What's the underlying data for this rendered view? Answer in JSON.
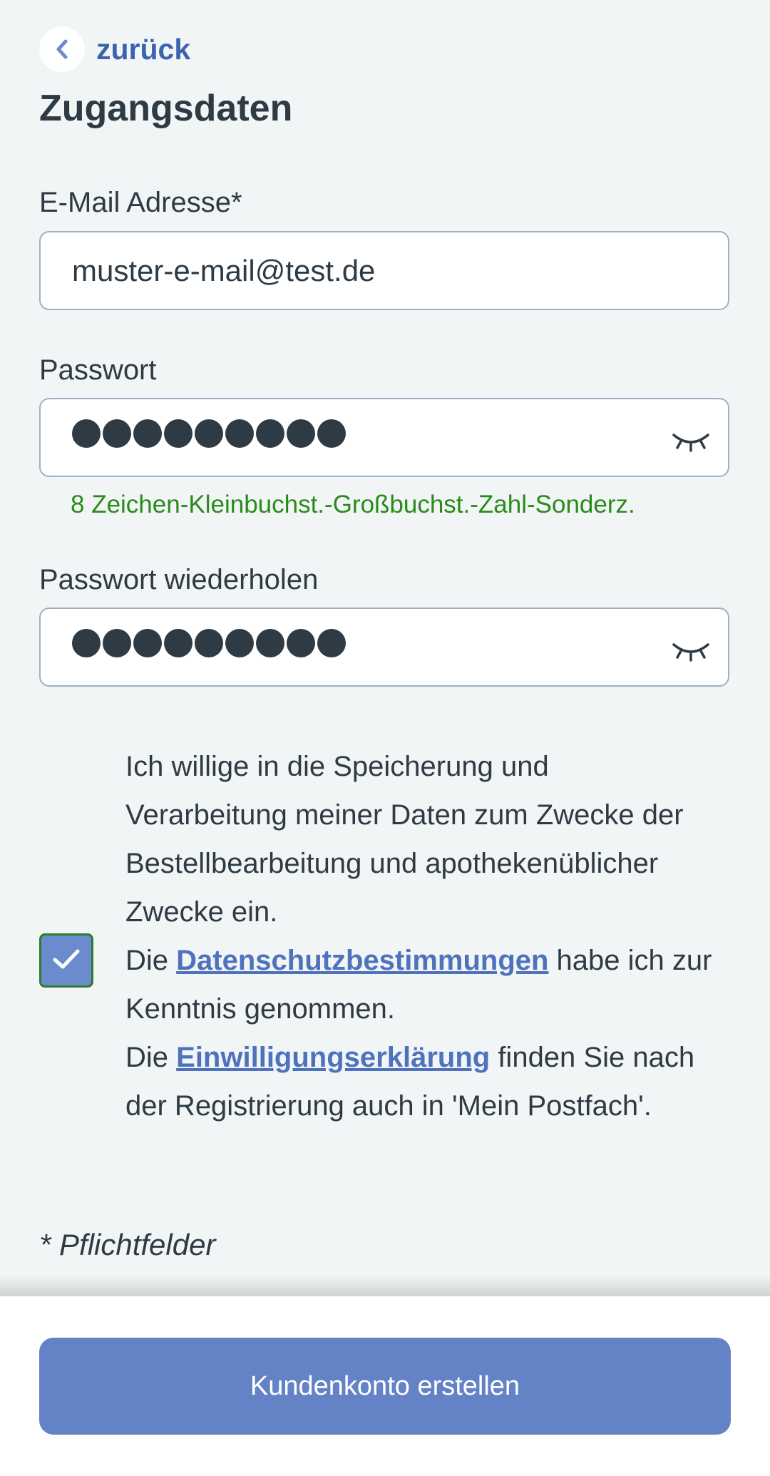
{
  "nav": {
    "back_label": "zurück"
  },
  "page": {
    "title": "Zugangsdaten"
  },
  "form": {
    "email": {
      "label": "E-Mail Adresse*",
      "value": "muster-e-mail@test.de"
    },
    "password": {
      "label": "Passwort",
      "masked_length": 9,
      "hint": "8 Zeichen-Kleinbuchst.-Großbuchst.-Zahl-Sonderz."
    },
    "password_repeat": {
      "label": "Passwort wiederholen",
      "masked_length": 9
    },
    "consent": {
      "checked": true,
      "text_1": "Ich willige in die Speicherung und Verarbeitung meiner Daten zum Zwecke der Bestellbearbeitung und apothekenüblicher Zwecke ein.",
      "text_2_prefix": "Die ",
      "privacy_link": "Datenschutzbestimmungen",
      "text_2_suffix": " habe ich zur Kenntnis genommen.",
      "text_3_prefix": "Die ",
      "consent_link": "Einwilligungserklärung",
      "text_3_suffix": " finden Sie nach der Registrierung auch in 'Mein Postfach'."
    },
    "required_note": "* Pflichtfelder"
  },
  "footer": {
    "submit_label": "Kundenkonto erstellen"
  },
  "colors": {
    "background": "#f1f5f6",
    "accent": "#3d63b0",
    "button": "#6383c6",
    "hint_green": "#2a8a1a",
    "text": "#2e3a44"
  },
  "icons": {
    "back": "chevron-left-icon",
    "eye": "eye-closed-icon",
    "check": "checkmark-icon"
  }
}
